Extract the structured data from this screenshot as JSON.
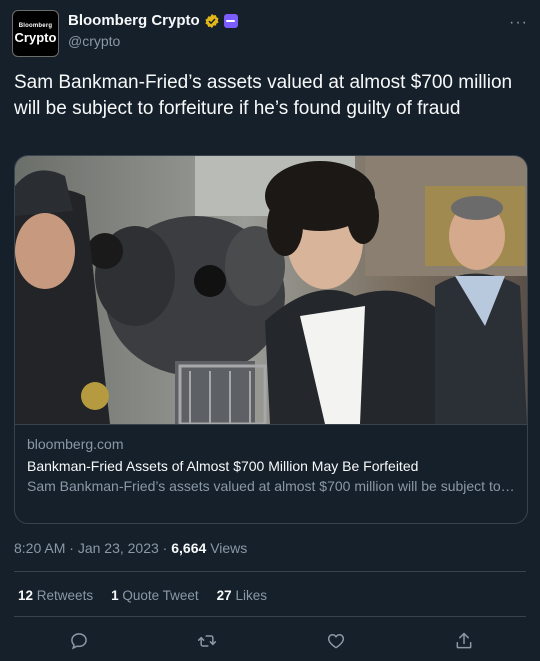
{
  "account": {
    "avatar_top": "Bloomberg",
    "avatar_bottom": "Crypto",
    "name": "Bloomberg Crypto",
    "handle": "@crypto",
    "verified_icon": "gold-verified-badge",
    "affiliate_icon": "affiliate-badge"
  },
  "tweet": {
    "text": "Sam Bankman-Fried’s assets valued at almost $700 million will be subject to forfeiture if he’s found guilty of fraud",
    "time": "8:20 AM",
    "date": "Jan 23, 2023",
    "views_count": "6,664",
    "views_label": "Views"
  },
  "card": {
    "domain": "bloomberg.com",
    "title": "Bankman-Fried Assets of Almost $700 Million May Be Forfeited",
    "description": "Sam Bankman-Fried’s assets valued at almost $700 million will be subject to forfeiture if he’s found guilty of fraud, according to federal prosecutors leading …"
  },
  "stats": {
    "retweets_count": "12",
    "retweets_label": "Retweets",
    "quotes_count": "1",
    "quotes_label": "Quote Tweet",
    "likes_count": "27",
    "likes_label": "Likes"
  },
  "actions": [
    "reply-icon",
    "retweet-icon",
    "like-icon",
    "share-icon"
  ],
  "colors": {
    "background": "#15202b",
    "secondary_text": "#8b98a5",
    "verified_gold": "#e2b719",
    "affiliate_purple": "#7b5cff"
  }
}
